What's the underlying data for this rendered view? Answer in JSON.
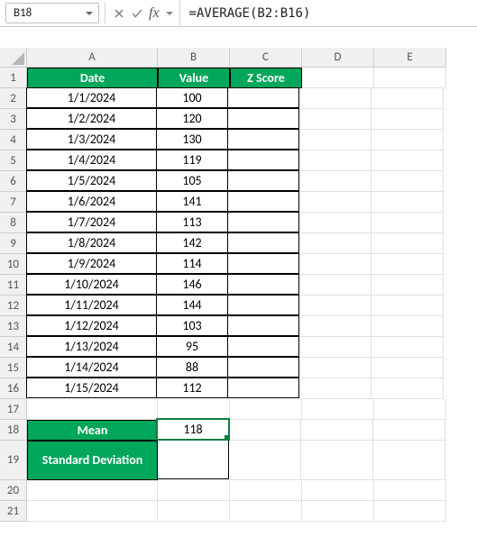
{
  "nameBox": "B18",
  "formula": "=AVERAGE(B2:B16)",
  "fxLabel": "fx",
  "columns": [
    "A",
    "B",
    "C",
    "D",
    "E"
  ],
  "colWidths": {
    "A": 145,
    "B": 80,
    "C": 80,
    "D": 80,
    "E": 80
  },
  "headerRowHeight": 23,
  "dataRowHeight": 23,
  "statLabelHeight": 23,
  "stdDevHeight": 44,
  "blankRowHeight": 23,
  "rowNumbers": [
    "1",
    "2",
    "3",
    "4",
    "5",
    "6",
    "7",
    "8",
    "9",
    "10",
    "11",
    "12",
    "13",
    "14",
    "15",
    "16",
    "17",
    "18",
    "19",
    "20",
    "21"
  ],
  "headers": {
    "A": "Date",
    "B": "Value",
    "C": "Z Score"
  },
  "dataRows": [
    {
      "date": "1/1/2024",
      "value": "100",
      "z": ""
    },
    {
      "date": "1/2/2024",
      "value": "120",
      "z": ""
    },
    {
      "date": "1/3/2024",
      "value": "130",
      "z": ""
    },
    {
      "date": "1/4/2024",
      "value": "119",
      "z": ""
    },
    {
      "date": "1/5/2024",
      "value": "105",
      "z": ""
    },
    {
      "date": "1/6/2024",
      "value": "141",
      "z": ""
    },
    {
      "date": "1/7/2024",
      "value": "113",
      "z": ""
    },
    {
      "date": "1/8/2024",
      "value": "142",
      "z": ""
    },
    {
      "date": "1/9/2024",
      "value": "114",
      "z": ""
    },
    {
      "date": "1/10/2024",
      "value": "146",
      "z": ""
    },
    {
      "date": "1/11/2024",
      "value": "144",
      "z": ""
    },
    {
      "date": "1/12/2024",
      "value": "103",
      "z": ""
    },
    {
      "date": "1/13/2024",
      "value": "95",
      "z": ""
    },
    {
      "date": "1/14/2024",
      "value": "88",
      "z": ""
    },
    {
      "date": "1/15/2024",
      "value": "112",
      "z": ""
    }
  ],
  "stats": {
    "meanLabel": "Mean",
    "meanValue": "118",
    "stdLabel": "Standard Deviation",
    "stdValue": ""
  },
  "selectedCell": "B18",
  "chart_data": {
    "type": "table",
    "title": "",
    "columns": [
      "Date",
      "Value",
      "Z Score"
    ],
    "rows": [
      [
        "1/1/2024",
        100,
        null
      ],
      [
        "1/2/2024",
        120,
        null
      ],
      [
        "1/3/2024",
        130,
        null
      ],
      [
        "1/4/2024",
        119,
        null
      ],
      [
        "1/5/2024",
        105,
        null
      ],
      [
        "1/6/2024",
        141,
        null
      ],
      [
        "1/7/2024",
        113,
        null
      ],
      [
        "1/8/2024",
        142,
        null
      ],
      [
        "1/9/2024",
        114,
        null
      ],
      [
        "1/10/2024",
        146,
        null
      ],
      [
        "1/11/2024",
        144,
        null
      ],
      [
        "1/12/2024",
        103,
        null
      ],
      [
        "1/13/2024",
        95,
        null
      ],
      [
        "1/14/2024",
        88,
        null
      ],
      [
        "1/15/2024",
        112,
        null
      ]
    ],
    "summary": {
      "Mean": 118,
      "Standard Deviation": null
    }
  }
}
